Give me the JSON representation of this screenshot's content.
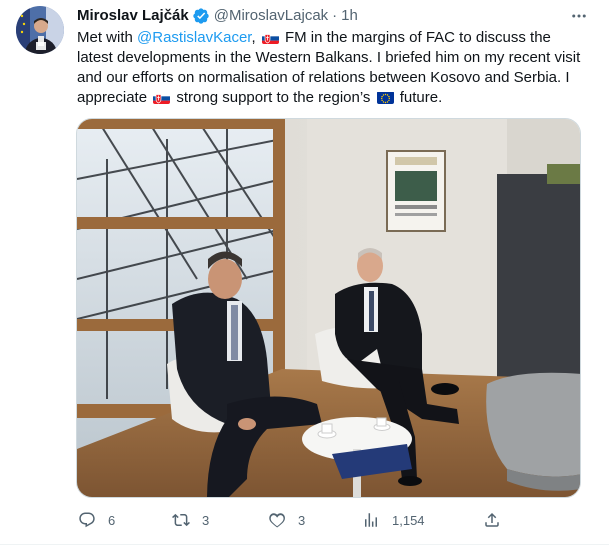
{
  "tweet": {
    "author_name": "Miroslav Lajčák",
    "handle": "@MiroslavLajcak",
    "separator": "·",
    "time": "1h",
    "text_parts": {
      "p1": "Met with ",
      "mention": "@RastislavKacer",
      "p2": ", ",
      "p3": " FM in the margins of FAC to discuss the latest developments in the Western Balkans. I briefed him on my recent visit and our efforts on normalisation of relations between Kosovo and Serbia. I appreciate ",
      "p4": " strong support to the region’s ",
      "p5": " future."
    },
    "flags": [
      "slovakia-flag",
      "slovakia-flag",
      "eu-flag"
    ],
    "image_alt": "Photo of two men in suits seated in a meeting room"
  },
  "actions": {
    "reply_count": "6",
    "retweet_count": "3",
    "like_count": "3",
    "view_count": "1,154"
  },
  "colors": {
    "accent": "#1d9bf0",
    "text": "#0f1419",
    "secondary": "#536471"
  }
}
